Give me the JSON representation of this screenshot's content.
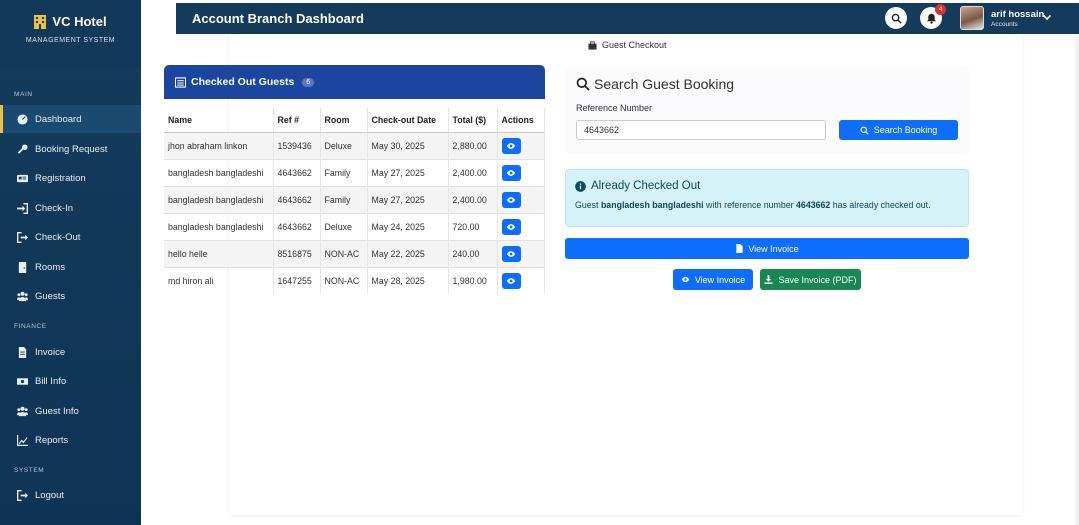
{
  "app": {
    "name": "VC Hotel",
    "subtitle": "MANAGEMENT SYSTEM"
  },
  "sidebar": {
    "sections": [
      {
        "label": "MAIN"
      },
      {
        "label": "FINANCE"
      },
      {
        "label": "SYSTEM"
      }
    ],
    "items": [
      {
        "label": "Dashboard",
        "icon": "dashboard-icon",
        "active": true
      },
      {
        "label": "Booking Request",
        "icon": "key-icon"
      },
      {
        "label": "Registration",
        "icon": "id-card-icon"
      },
      {
        "label": "Check-In",
        "icon": "sign-in-icon"
      },
      {
        "label": "Check-Out",
        "icon": "sign-out-icon"
      },
      {
        "label": "Rooms",
        "icon": "door-icon"
      },
      {
        "label": "Guests",
        "icon": "users-icon"
      },
      {
        "label": "Invoice",
        "icon": "file-invoice-icon"
      },
      {
        "label": "Bill Info",
        "icon": "money-icon"
      },
      {
        "label": "Guest Info",
        "icon": "users-icon"
      },
      {
        "label": "Reports",
        "icon": "chart-icon"
      },
      {
        "label": "Logout",
        "icon": "logout-icon"
      }
    ]
  },
  "header": {
    "title": "Account Branch Dashboard",
    "notification_count": "4",
    "user_name": "arif hossain",
    "user_role": "Accounts"
  },
  "page": {
    "breadcrumb": "Guest Checkout"
  },
  "checked_out": {
    "title": "Checked Out Guests",
    "count": "6",
    "columns": [
      "Name",
      "Ref #",
      "Room",
      "Check-out Date",
      "Total ($)",
      "Actions"
    ],
    "rows": [
      {
        "name": "jhon abraham linkon",
        "ref": "1539436",
        "room": "Deluxe",
        "date": "May 30, 2025",
        "total": "2,880.00"
      },
      {
        "name": "bangladesh bangladeshi",
        "ref": "4643662",
        "room": "Family",
        "date": "May 27, 2025",
        "total": "2,400.00"
      },
      {
        "name": "bangladesh bangladeshi",
        "ref": "4643662",
        "room": "Family",
        "date": "May 27, 2025",
        "total": "2,400.00"
      },
      {
        "name": "bangladesh bangladeshi",
        "ref": "4643662",
        "room": "Deluxe",
        "date": "May 24, 2025",
        "total": "720.00"
      },
      {
        "name": "hello helle",
        "ref": "8516875",
        "room": "NON-AC",
        "date": "May 22, 2025",
        "total": "240.00"
      },
      {
        "name": "md hiron ali",
        "ref": "1647255",
        "room": "NON-AC",
        "date": "May 28, 2025",
        "total": "1,980.00"
      }
    ]
  },
  "search": {
    "title": "Search Guest Booking",
    "ref_label": "Reference Number",
    "ref_value": "4643662",
    "button_label": "Search Booking"
  },
  "alert": {
    "title": "Already Checked Out",
    "msg_prefix": "Guest",
    "guest_name": "bangladesh bangladeshi",
    "msg_mid": "with reference number",
    "ref": "4643662",
    "msg_suffix": "has already checked out."
  },
  "actions": {
    "view_invoice_wide": "View Invoice",
    "view_invoice": "View Invoice",
    "save_invoice": "Save Invoice (PDF)"
  },
  "colors": {
    "sidebar_bg": "#143c5c",
    "header_bg": "#143a5c",
    "card_header": "#1a46a0",
    "primary": "#0d6efd",
    "success": "#198754",
    "alert_bg": "#d4f2f8"
  }
}
